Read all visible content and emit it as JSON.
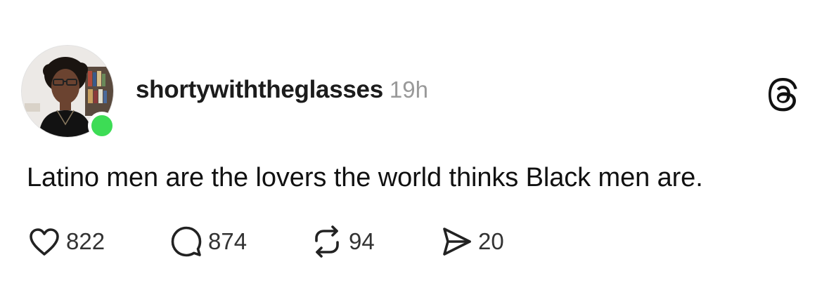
{
  "post": {
    "author": {
      "username": "shortywiththeglasses",
      "online": true
    },
    "timestamp": "19h",
    "text": "Latino men are the lovers the world thinks Black men are.",
    "stats": {
      "likes": "822",
      "replies": "874",
      "reposts": "94",
      "shares": "20"
    }
  },
  "icons": {
    "brand": "threads-logo-icon",
    "like": "heart-icon",
    "reply": "speech-bubble-icon",
    "repost": "repost-icon",
    "share": "send-icon"
  },
  "colors": {
    "online_indicator": "#3ddc55",
    "timestamp": "#999999",
    "text": "#111111"
  }
}
